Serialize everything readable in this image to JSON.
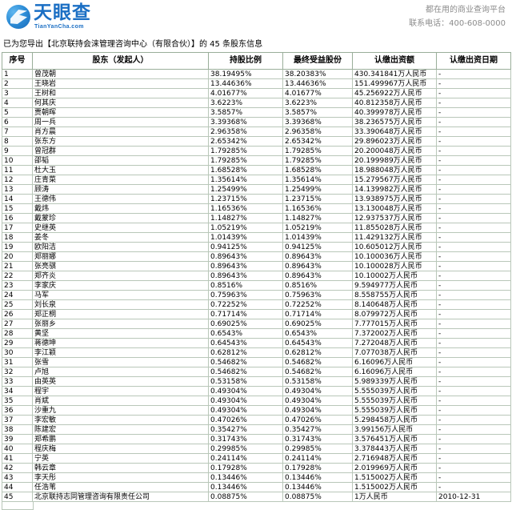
{
  "header": {
    "logo_cn": "天眼查",
    "logo_en": "TianYanCha.com",
    "tagline": "都在用的商业查询平台",
    "contact": "联系电话：400-608-0000"
  },
  "export_note": "已为您导出【北京联持会涞管理咨询中心（有限合伙）】的 45 条股东信息",
  "table": {
    "columns": [
      "序号",
      "股东（发起人）",
      "持股比例",
      "最终受益股份",
      "认缴出资额",
      "认缴出资日期"
    ],
    "rows": [
      [
        "1",
        "曾茂朝",
        "38.19495%",
        "38.20383%",
        "430.341841万人民币",
        "-"
      ],
      [
        "2",
        "王晓岩",
        "13.44636%",
        "13.44636%",
        "151.499967万人民币",
        "-"
      ],
      [
        "3",
        "王树和",
        "4.01677%",
        "4.01677%",
        "45.256922万人民币",
        "-"
      ],
      [
        "4",
        "何其庆",
        "3.6223%",
        "3.6223%",
        "40.812358万人民币",
        "-"
      ],
      [
        "5",
        "贾朝晖",
        "3.5857%",
        "3.5857%",
        "40.399978万人民币",
        "-"
      ],
      [
        "6",
        "周一兵",
        "3.39368%",
        "3.39368%",
        "38.236575万人民币",
        "-"
      ],
      [
        "7",
        "肖方晨",
        "2.96358%",
        "2.96358%",
        "33.390648万人民币",
        "-"
      ],
      [
        "8",
        "张东方",
        "2.65342%",
        "2.65342%",
        "29.896023万人民币",
        "-"
      ],
      [
        "9",
        "曾冠群",
        "1.79285%",
        "1.79285%",
        "20.200048万人民币",
        "-"
      ],
      [
        "10",
        "邵韬",
        "1.79285%",
        "1.79285%",
        "20.199989万人民币",
        "-"
      ],
      [
        "11",
        "杜大玉",
        "1.68528%",
        "1.68528%",
        "18.988048万人民币",
        "-"
      ],
      [
        "12",
        "庄青菜",
        "1.35614%",
        "1.35614%",
        "15.279567万人民币",
        "-"
      ],
      [
        "13",
        "顾涛",
        "1.25499%",
        "1.25499%",
        "14.139982万人民币",
        "-"
      ],
      [
        "14",
        "王德伟",
        "1.23715%",
        "1.23715%",
        "13.938975万人民币",
        "-"
      ],
      [
        "15",
        "戴炜",
        "1.16536%",
        "1.16536%",
        "13.130048万人民币",
        "-"
      ],
      [
        "16",
        "戴蒙珍",
        "1.14827%",
        "1.14827%",
        "12.937537万人民币",
        "-"
      ],
      [
        "17",
        "史继英",
        "1.05219%",
        "1.05219%",
        "11.855028万人民币",
        "-"
      ],
      [
        "18",
        "姜冬",
        "1.01439%",
        "1.01439%",
        "11.429132万人民币",
        "-"
      ],
      [
        "19",
        "欧阳洁",
        "0.94125%",
        "0.94125%",
        "10.605012万人民币",
        "-"
      ],
      [
        "20",
        "郑丽娜",
        "0.89643%",
        "0.89643%",
        "10.100036万人民币",
        "-"
      ],
      [
        "21",
        "张亮骐",
        "0.89643%",
        "0.89643%",
        "10.100028万人民币",
        "-"
      ],
      [
        "22",
        "郑齐炎",
        "0.89643%",
        "0.89643%",
        "10.10002万人民币",
        "-"
      ],
      [
        "23",
        "李家庆",
        "0.8516%",
        "0.8516%",
        "9.594977万人民币",
        "-"
      ],
      [
        "24",
        "马军",
        "0.75963%",
        "0.75963%",
        "8.558755万人民币",
        "-"
      ],
      [
        "25",
        "刘长泉",
        "0.72252%",
        "0.72252%",
        "8.140648万人民币",
        "-"
      ],
      [
        "26",
        "郑正桐",
        "0.71714%",
        "0.71714%",
        "8.079972万人民币",
        "-"
      ],
      [
        "27",
        "张丽乡",
        "0.69025%",
        "0.69025%",
        "7.777015万人民币",
        "-"
      ],
      [
        "28",
        "黄坚",
        "0.6543%",
        "0.6543%",
        "7.372002万人民币",
        "-"
      ],
      [
        "29",
        "蒋德坤",
        "0.64543%",
        "0.64543%",
        "7.272048万人民币",
        "-"
      ],
      [
        "30",
        "李江颖",
        "0.62812%",
        "0.62812%",
        "7.077038万人民币",
        "-"
      ],
      [
        "31",
        "张雪",
        "0.54682%",
        "0.54682%",
        "6.16096万人民币",
        "-"
      ],
      [
        "32",
        "卢旭",
        "0.54682%",
        "0.54682%",
        "6.16096万人民币",
        "-"
      ],
      [
        "33",
        "由英英",
        "0.53158%",
        "0.53158%",
        "5.989339万人民币",
        "-"
      ],
      [
        "34",
        "程宇",
        "0.49304%",
        "0.49304%",
        "5.555039万人民币",
        "-"
      ],
      [
        "35",
        "肖斌",
        "0.49304%",
        "0.49304%",
        "5.555039万人民币",
        "-"
      ],
      [
        "36",
        "沙重九",
        "0.49304%",
        "0.49304%",
        "5.555039万人民币",
        "-"
      ],
      [
        "37",
        "李宏敏",
        "0.47026%",
        "0.47026%",
        "5.298458万人民币",
        "-"
      ],
      [
        "38",
        "陈建宏",
        "0.35427%",
        "0.35427%",
        "3.99156万人民币",
        "-"
      ],
      [
        "39",
        "郑希鹏",
        "0.31743%",
        "0.31743%",
        "3.576451万人民币",
        "-"
      ],
      [
        "40",
        "程庆梅",
        "0.29985%",
        "0.29985%",
        "3.378443万人民币",
        "-"
      ],
      [
        "41",
        "宁英",
        "0.24114%",
        "0.24114%",
        "2.716948万人民币",
        "-"
      ],
      [
        "42",
        "韩云章",
        "0.17928%",
        "0.17928%",
        "2.019969万人民币",
        "-"
      ],
      [
        "43",
        "李天彤",
        "0.13446%",
        "0.13446%",
        "1.515002万人民币",
        "-"
      ],
      [
        "44",
        "任浩苇",
        "0.13446%",
        "0.13446%",
        "1.515002万人民币",
        "-"
      ],
      [
        "45",
        "北京联持志同管理咨询有限责任公司",
        "0.08875%",
        "0.08875%",
        "1万人民币",
        "2010-12-31"
      ]
    ]
  }
}
